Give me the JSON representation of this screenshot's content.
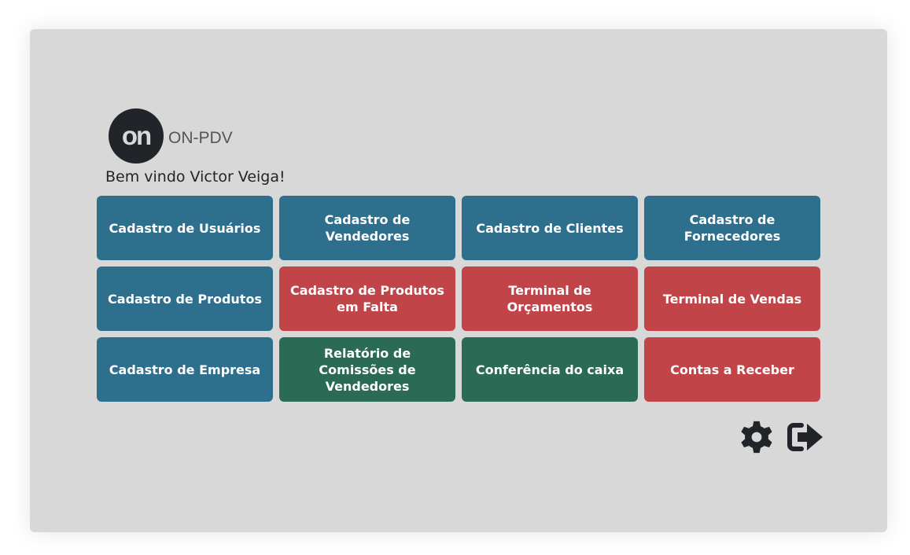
{
  "brand": {
    "logo_text": "on",
    "name": "ON-PDV"
  },
  "welcome": "Bem vindo Victor Veiga!",
  "tiles": [
    {
      "label": "Cadastro de Usuários",
      "color": "#2e6f8e"
    },
    {
      "label": "Cadastro de Vendedores",
      "color": "#2e6f8e"
    },
    {
      "label": "Cadastro de Clientes",
      "color": "#2e6f8e"
    },
    {
      "label": "Cadastro de Fornecedores",
      "color": "#2e6f8e"
    },
    {
      "label": "Cadastro de Produtos",
      "color": "#2e6f8e"
    },
    {
      "label": "Cadastro de Produtos em Falta",
      "color": "#c04448"
    },
    {
      "label": "Terminal de Orçamentos",
      "color": "#c04448"
    },
    {
      "label": "Terminal de Vendas",
      "color": "#c04448"
    },
    {
      "label": "Cadastro de Empresa",
      "color": "#2e6f8e"
    },
    {
      "label": "Relatório de Comissões de Vendedores",
      "color": "#2b6b55"
    },
    {
      "label": "Conferência do caixa",
      "color": "#2b6b55"
    },
    {
      "label": "Contas a Receber",
      "color": "#c04448"
    }
  ],
  "actions": [
    {
      "icon": "gear-icon"
    },
    {
      "icon": "sign-out-icon"
    }
  ],
  "colors": {
    "background": "#d8d8d8",
    "primary": "#2e6f8e",
    "danger": "#c04448",
    "success": "#2b6b55",
    "dark": "#212529"
  }
}
